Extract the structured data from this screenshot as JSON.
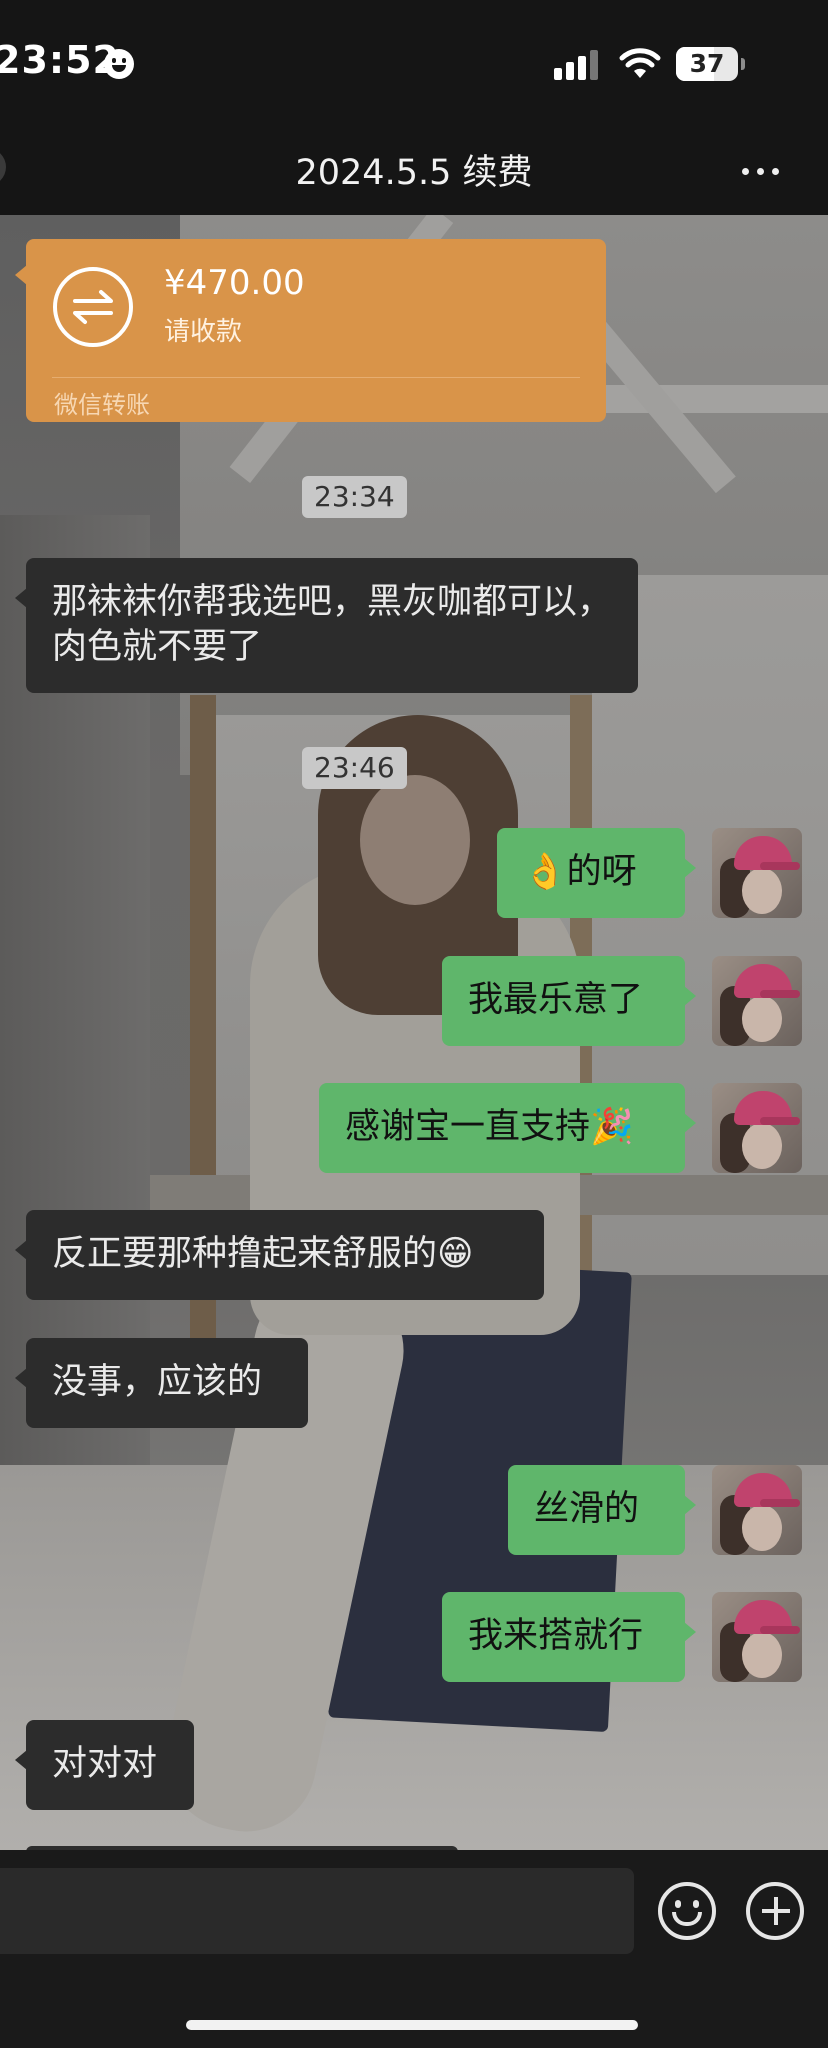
{
  "status_bar": {
    "time": "23:52",
    "battery": "37"
  },
  "nav": {
    "title": "2024.5.5 续费"
  },
  "transfer": {
    "amount": "¥470.00",
    "status": "请收款",
    "source": "微信转账"
  },
  "timestamps": [
    "23:34",
    "23:46"
  ],
  "messages": [
    {
      "side": "left",
      "text": "那袜袜你帮我选吧，黑灰咖都可以，"
    },
    {
      "side": "left",
      "text": "肉色就不要了"
    },
    {
      "side": "right",
      "text": "👌的呀"
    },
    {
      "side": "right",
      "text": "我最乐意了"
    },
    {
      "side": "right",
      "text": "感谢宝一直支持🎉"
    },
    {
      "side": "left",
      "text": "反正要那种撸起来舒服的😁"
    },
    {
      "side": "left",
      "text": "没事，应该的"
    },
    {
      "side": "right",
      "text": "丝滑的"
    },
    {
      "side": "right",
      "text": "我来搭就行"
    },
    {
      "side": "left",
      "text": "对对对"
    }
  ],
  "colors": {
    "incoming_bubble": "#2c2c2c",
    "outgoing_bubble": "#5fb66b",
    "transfer_card": "#d99449",
    "bar_background": "#151515"
  },
  "icons": {
    "transfer": "transfer-arrows-icon",
    "emoji": "smiley-icon",
    "plus": "plus-circle-icon",
    "more": "more-dots-icon"
  }
}
